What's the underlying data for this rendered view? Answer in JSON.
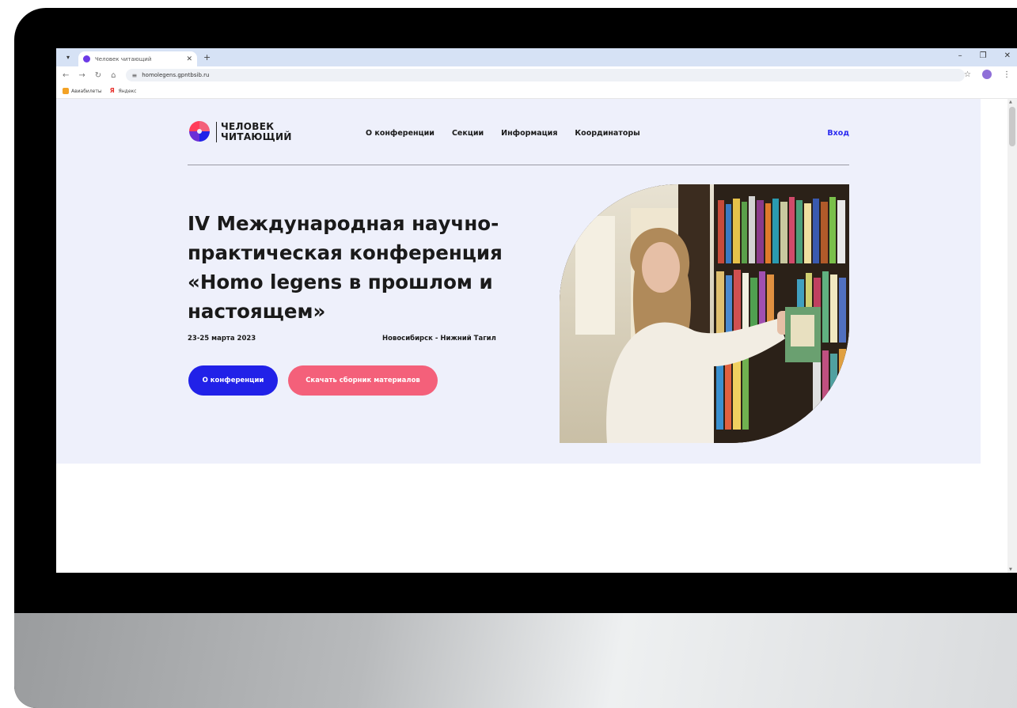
{
  "browser": {
    "tab_title": "Человек читающий",
    "url": "homolegens.gpntbsib.ru",
    "bookmarks": [
      "Авиабилеты",
      "Яндекс"
    ]
  },
  "site": {
    "logo_line1": "ЧЕЛОВЕК",
    "logo_line2": "ЧИТАЮЩИЙ",
    "nav": [
      "О конференции",
      "Секции",
      "Информация",
      "Координаторы"
    ],
    "login": "Вход"
  },
  "hero": {
    "title": "IV Международная научно-практическая конференция «Homo legens в прошлом и настоящем»",
    "date": "23-25 марта 2023",
    "place": "Новосибирск - Нижний Тагил",
    "btn_primary": "О конференции",
    "btn_secondary": "Скачать сборник материалов"
  },
  "colors": {
    "accent_blue": "#2121e8",
    "accent_pink": "#f4607a",
    "hero_bg": "#eef0fb"
  }
}
